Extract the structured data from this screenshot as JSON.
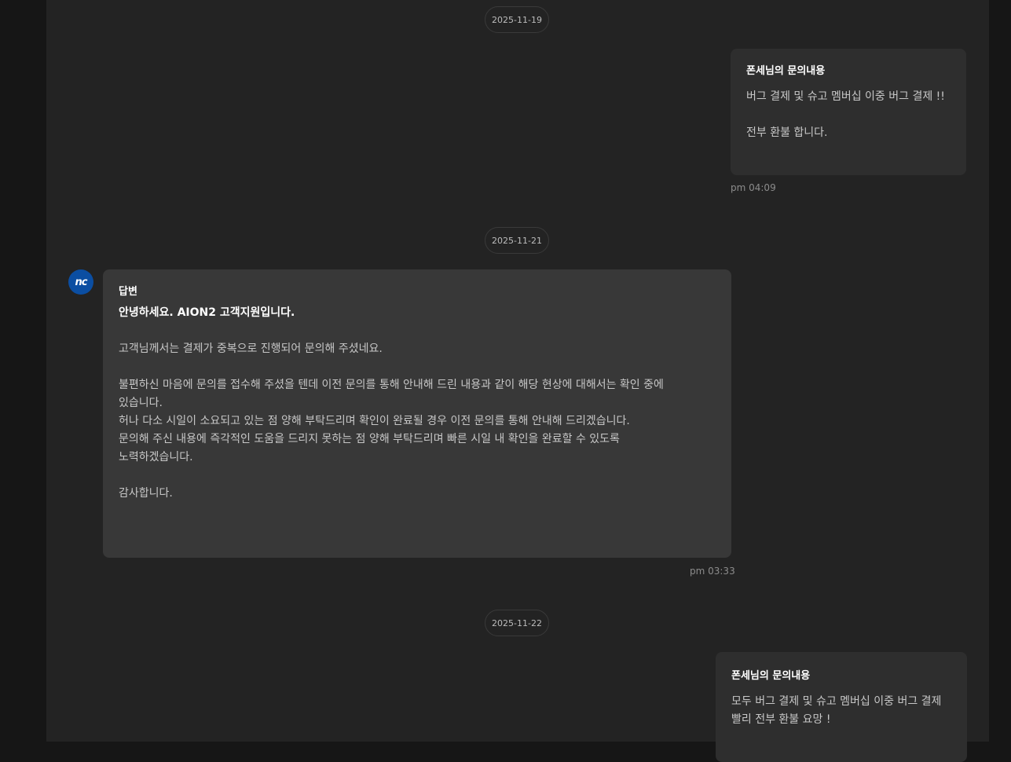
{
  "dates": [
    "2025-11-19",
    "2025-11-21",
    "2025-11-22"
  ],
  "messages": [
    {
      "title": "폰세님의 문의내용",
      "body": "버그 결제 및 슈고 멤버십 이중 버그 결제 !!\n\n전부 환불 합니다.",
      "time": "pm 04:09"
    },
    {
      "avatar_text": "nc",
      "title": "답변",
      "greeting": "안녕하세요. AION2 고객지원입니다.",
      "body": "\n고객님께서는 결제가 중복으로 진행되어 문의해 주셨네요.\n\n불편하신 마음에 문의를 접수해 주셨을 텐데 이전 문의를 통해 안내해 드린 내용과 같이 해당 현상에 대해서는 확인 중에\n있습니다.\n허나 다소 시일이 소요되고 있는 점 양해 부탁드리며 확인이 완료될 경우 이전 문의를 통해 안내해 드리겠습니다.\n문의해 주신 내용에 즉각적인 도움을 드리지 못하는 점 양해 부탁드리며 빠른 시일 내 확인을 완료할 수 있도록\n노력하겠습니다.\n\n감사합니다.",
      "time": "pm 03:33"
    },
    {
      "title": "폰세님의 문의내용",
      "body": "모두 버그 결제 및 슈고 멤버십 이중 버그 결제\n빨리 전부 환불 요망 !"
    }
  ],
  "colors": {
    "avatar_bg": "#0b4ea2",
    "panel_bg": "#232323",
    "bubble_bg": "#2e2e2e"
  }
}
